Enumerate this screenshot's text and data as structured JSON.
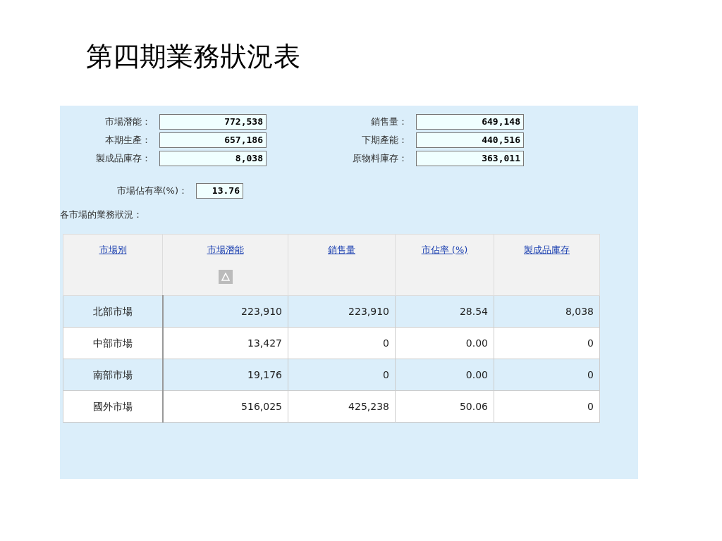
{
  "title": "第四期業務狀況表",
  "fields": [
    {
      "label": "市場潛能：",
      "value": "772,538"
    },
    {
      "label": "銷售量：",
      "value": "649,148"
    },
    {
      "label": "本期生產：",
      "value": "657,186"
    },
    {
      "label": "下期產能：",
      "value": "440,516"
    },
    {
      "label": "製成品庫存：",
      "value": "8,038"
    },
    {
      "label": "原物料庫存：",
      "value": "363,011"
    }
  ],
  "share": {
    "label": "市場佔有率(%)：",
    "value": "13.76"
  },
  "section_label": "各市場的業務狀況：",
  "table": {
    "columns": [
      {
        "label": "市場別",
        "sorted": false
      },
      {
        "label": "市場潛能",
        "sorted": true
      },
      {
        "label": "銷售量",
        "sorted": false
      },
      {
        "label": "市佔率 (%)",
        "sorted": false
      },
      {
        "label": "製成品庫存",
        "sorted": false
      }
    ],
    "rows": [
      {
        "shaded": true,
        "cells": [
          "北部市場",
          "223,910",
          "223,910",
          "28.54",
          "8,038"
        ]
      },
      {
        "shaded": false,
        "cells": [
          "中部市場",
          "13,427",
          "0",
          "0.00",
          "0"
        ]
      },
      {
        "shaded": true,
        "cells": [
          "南部市場",
          "19,176",
          "0",
          "0.00",
          "0"
        ]
      },
      {
        "shaded": false,
        "cells": [
          "國外市場",
          "516,025",
          "425,238",
          "50.06",
          "0"
        ]
      }
    ]
  }
}
